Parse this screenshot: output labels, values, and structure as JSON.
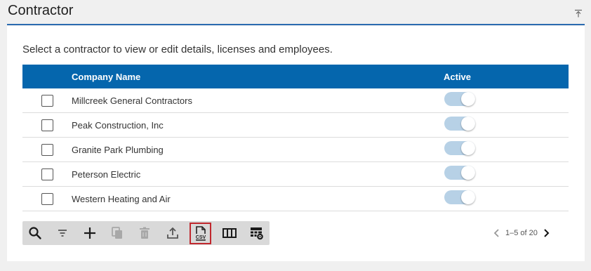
{
  "header": {
    "title": "Contractor",
    "collapse_icon": "collapse-up-icon"
  },
  "intro": "Select a contractor to view or edit details, licenses and employees.",
  "table": {
    "columns": [
      "Company Name",
      "Active"
    ],
    "rows": [
      {
        "name": "Millcreek General Contractors",
        "active": true
      },
      {
        "name": "Peak Construction, Inc",
        "active": true
      },
      {
        "name": "Granite Park Plumbing",
        "active": true
      },
      {
        "name": "Peterson Electric",
        "active": true
      },
      {
        "name": "Western Heating and Air",
        "active": true
      }
    ]
  },
  "toolbar": {
    "buttons": [
      "search-icon",
      "filter-icon",
      "add-icon",
      "copy-icon",
      "delete-icon",
      "export-icon",
      "csv-icon",
      "columns-icon",
      "table-settings-icon"
    ],
    "csv_label": "CSV"
  },
  "pager": {
    "info": "1–5 of 20"
  },
  "colors": {
    "accent": "#0566ad",
    "header_rule": "#2b6bb0",
    "toggle_track": "#b7d1e6",
    "highlight": "#c0282e"
  }
}
